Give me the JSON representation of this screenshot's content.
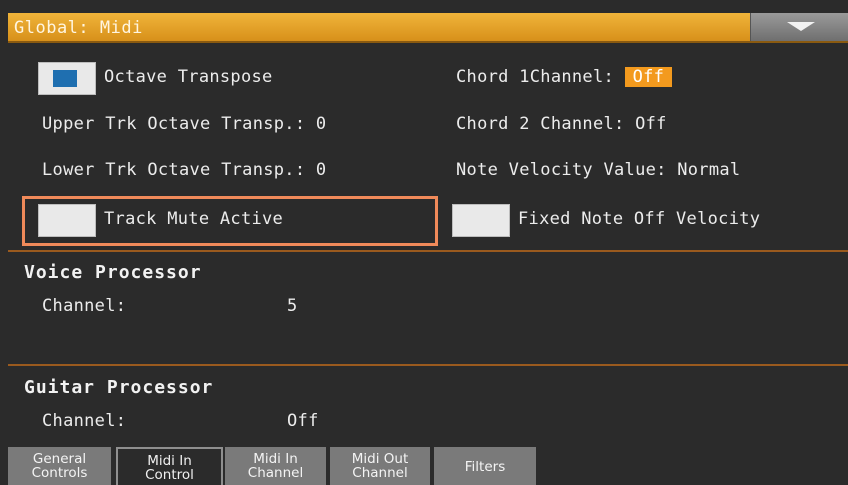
{
  "window": {
    "title": "Global: Midi"
  },
  "options": {
    "octave_transpose": {
      "label": "Octave Transpose",
      "checked": true
    },
    "upper_trk_octave_transp": "Upper Trk Octave Transp.: 0",
    "lower_trk_octave_transp": "Lower Trk Octave Transp.: 0",
    "track_mute_active": {
      "label": "Track Mute Active",
      "checked": false
    },
    "chord1_channel": {
      "label": "Chord 1Channel:",
      "value": "Off"
    },
    "chord2_channel": "Chord 2 Channel: Off",
    "note_velocity_value": "Note Velocity Value: Normal",
    "fixed_note_off_velocity": {
      "label": "Fixed Note Off Velocity",
      "checked": false
    }
  },
  "voice_processor": {
    "title": "Voice Processor",
    "channel_label": "Channel:",
    "channel_value": "5"
  },
  "guitar_processor": {
    "title": "Guitar Processor",
    "channel_label": "Channel:",
    "channel_value": "Off"
  },
  "tabs": [
    {
      "line1": "General",
      "line2": "Controls",
      "active": false
    },
    {
      "line1": "Midi In",
      "line2": "Control",
      "active": true
    },
    {
      "line1": "Midi In",
      "line2": "Channel",
      "active": false
    },
    {
      "line1": "Midi Out",
      "line2": "Channel",
      "active": false
    },
    {
      "line1": "Filters",
      "line2": "",
      "active": false
    }
  ],
  "colors": {
    "title_bar": "#e3a12a",
    "accent": "#f39a1e",
    "highlight_box": "#f08a5a",
    "divider": "#9a5a1e",
    "checkbox_mark": "#1f6fb0"
  }
}
